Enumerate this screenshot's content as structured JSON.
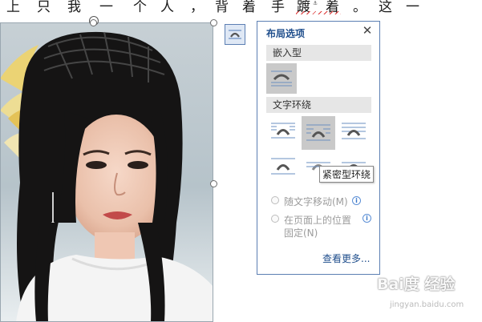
{
  "document": {
    "line_chars": [
      "上",
      "只",
      "我",
      "一",
      "个",
      "人",
      "，",
      "背",
      "着",
      "手",
      "踱",
      "着",
      "。",
      "这",
      "一"
    ]
  },
  "picture": {
    "description_icon": "portrait-photo"
  },
  "layout_panel": {
    "title": "布局选项",
    "close_glyph": "✕",
    "inline_section": "嵌入型",
    "wrap_section": "文字环绕",
    "tooltip": "紧密型环绕",
    "move_with_text": "随文字移动(M)",
    "fix_position": "在页面上的位置",
    "fix_position_line2": "固定(N)",
    "see_more": "查看更多..."
  },
  "colors": {
    "accent": "#1f4e8c",
    "border": "#5c7fb3",
    "selected_bg": "#c9c9c9"
  },
  "watermark": {
    "text": "Bai度 经验",
    "url": "jingyan.baidu.com"
  }
}
